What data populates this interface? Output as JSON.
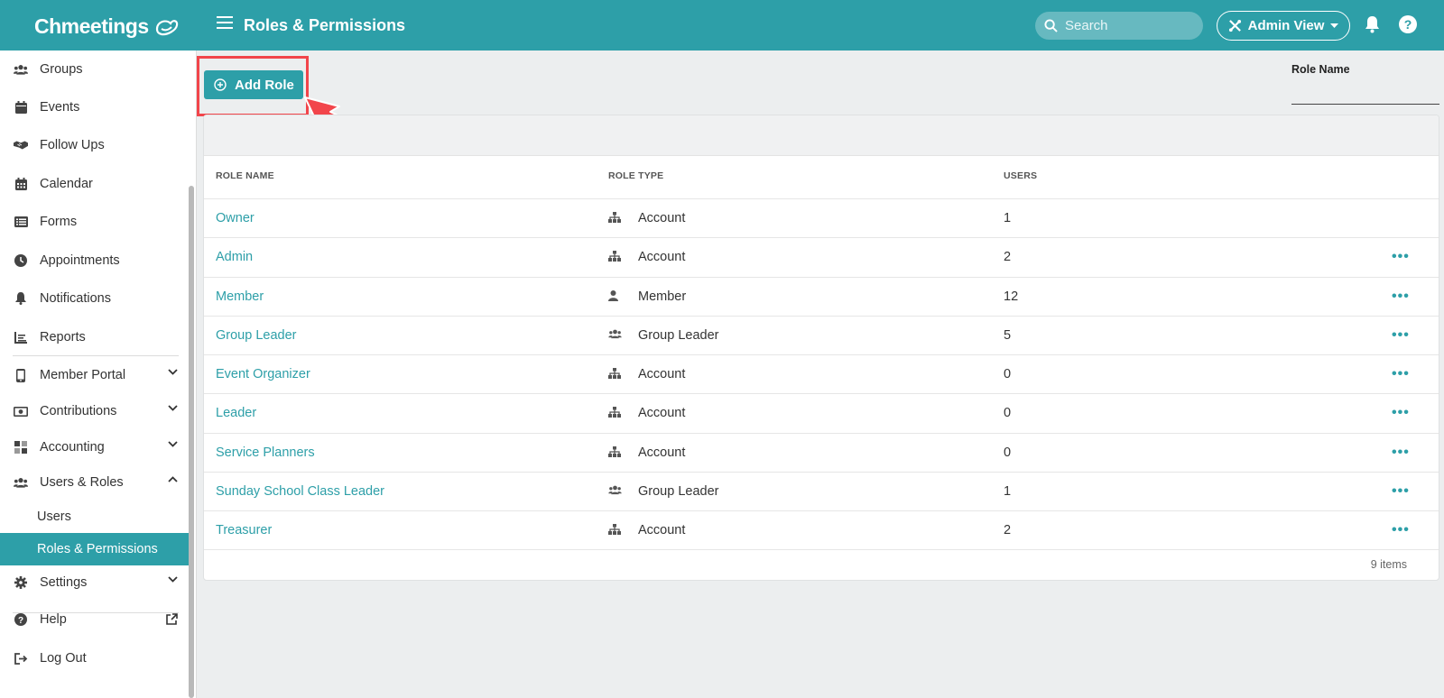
{
  "header": {
    "logo": "Chmeetings",
    "title": "Roles & Permissions",
    "search_placeholder": "Search",
    "view_label": "Admin View"
  },
  "sidebar": {
    "items": [
      {
        "label": "Groups",
        "icon": "users-icon"
      },
      {
        "label": "Events",
        "icon": "calendar-icon"
      },
      {
        "label": "Follow Ups",
        "icon": "handshake-icon"
      },
      {
        "label": "Calendar",
        "icon": "calendar-grid-icon"
      },
      {
        "label": "Forms",
        "icon": "list-icon"
      },
      {
        "label": "Appointments",
        "icon": "clock-icon"
      },
      {
        "label": "Notifications",
        "icon": "bell-icon"
      },
      {
        "label": "Reports",
        "icon": "chart-icon"
      },
      {
        "label": "Member Portal",
        "icon": "phone-icon"
      },
      {
        "label": "Contributions",
        "icon": "money-icon"
      },
      {
        "label": "Accounting",
        "icon": "grid-icon"
      },
      {
        "label": "Users & Roles",
        "icon": "users-icon"
      },
      {
        "label": "Settings",
        "icon": "gear-icon"
      },
      {
        "label": "Help",
        "icon": "question-icon"
      },
      {
        "label": "Log Out",
        "icon": "logout-icon"
      }
    ],
    "subitems": [
      {
        "label": "Users"
      },
      {
        "label": "Roles & Permissions"
      }
    ]
  },
  "toolbar": {
    "add_role_label": "Add Role",
    "filter_label": "Role Name"
  },
  "table": {
    "columns": [
      "ROLE NAME",
      "ROLE TYPE",
      "USERS"
    ],
    "rows": [
      {
        "name": "Owner",
        "type": "Account",
        "users": "1"
      },
      {
        "name": "Admin",
        "type": "Account",
        "users": "2"
      },
      {
        "name": "Member",
        "type": "Member",
        "users": "12"
      },
      {
        "name": "Group Leader",
        "type": "Group Leader",
        "users": "5"
      },
      {
        "name": "Event Organizer",
        "type": "Account",
        "users": "0"
      },
      {
        "name": "Leader",
        "type": "Account",
        "users": "0"
      },
      {
        "name": "Service Planners",
        "type": "Account",
        "users": "0"
      },
      {
        "name": "Sunday School Class Leader",
        "type": "Group Leader",
        "users": "1"
      },
      {
        "name": "Treasurer",
        "type": "Account",
        "users": "2"
      }
    ],
    "count_label": "9 items"
  },
  "colors": {
    "accent": "#2d9fa8",
    "highlight": "#f2454b"
  }
}
